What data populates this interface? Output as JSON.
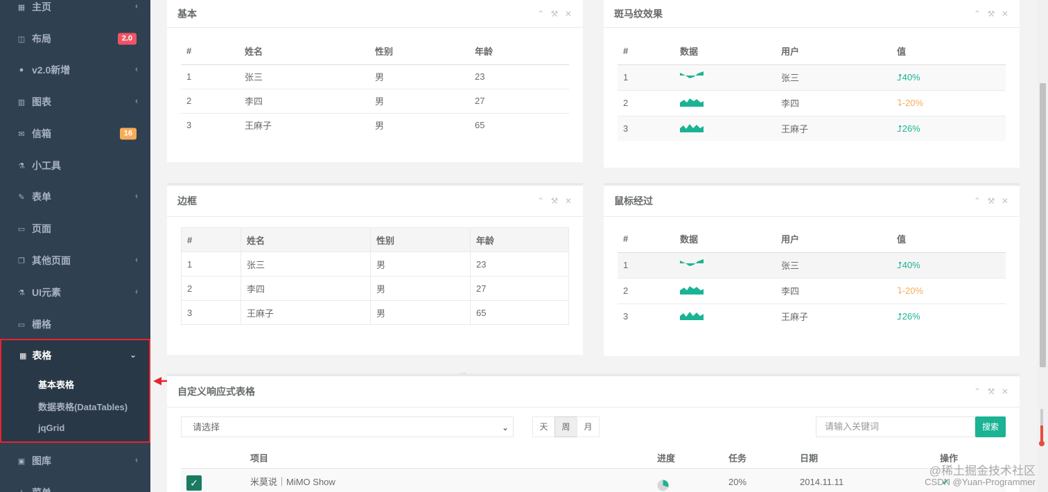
{
  "sidebar": {
    "items": [
      {
        "label": "主页",
        "icon": "grid-icon",
        "chev": "‹"
      },
      {
        "label": "布局",
        "icon": "columns-icon",
        "badge": "2.0",
        "badge_color": "#ed5565"
      },
      {
        "label": "v2.0新增",
        "icon": "globe-icon",
        "chev": "‹"
      },
      {
        "label": "图表",
        "icon": "bar-chart-icon",
        "chev": "‹"
      },
      {
        "label": "信箱",
        "icon": "envelope-icon",
        "badge": "16",
        "badge_color": "#f8ac59"
      },
      {
        "label": "小工具",
        "icon": "flask-icon"
      },
      {
        "label": "表单",
        "icon": "edit-icon",
        "chev": "‹"
      },
      {
        "label": "页面",
        "icon": "desktop-icon"
      },
      {
        "label": "其他页面",
        "icon": "files-icon",
        "chev": "‹"
      },
      {
        "label": "UI元素",
        "icon": "flask-icon",
        "chev": "‹"
      },
      {
        "label": "栅格",
        "icon": "laptop-icon"
      }
    ],
    "active": {
      "label": "表格",
      "chev": "⌄",
      "subitems": [
        "基本表格",
        "数据表格(DataTables)",
        "jqGrid"
      ]
    },
    "after": [
      {
        "label": "图库",
        "icon": "picture-icon",
        "chev": "‹"
      },
      {
        "label": "菜单",
        "icon": "sitemap-icon"
      }
    ]
  },
  "panels": {
    "basic": {
      "title": "基本",
      "headers": [
        "#",
        "姓名",
        "性别",
        "年龄"
      ],
      "rows": [
        [
          "1",
          "张三",
          "男",
          "23"
        ],
        [
          "2",
          "李四",
          "男",
          "27"
        ],
        [
          "3",
          "王麻子",
          "男",
          "65"
        ]
      ]
    },
    "zebra": {
      "title": "斑马纹效果",
      "headers": [
        "#",
        "数据",
        "用户",
        "值"
      ],
      "rows": [
        {
          "n": "1",
          "user": "张三",
          "value": "40%",
          "trend": "up"
        },
        {
          "n": "2",
          "user": "李四",
          "value": "-20%",
          "trend": "down"
        },
        {
          "n": "3",
          "user": "王麻子",
          "value": "26%",
          "trend": "up"
        }
      ]
    },
    "bordered": {
      "title": "边框",
      "headers": [
        "#",
        "姓名",
        "性别",
        "年龄"
      ],
      "rows": [
        [
          "1",
          "张三",
          "男",
          "23"
        ],
        [
          "2",
          "李四",
          "男",
          "27"
        ],
        [
          "3",
          "王麻子",
          "男",
          "65"
        ]
      ]
    },
    "hover": {
      "title": "鼠标经过",
      "headers": [
        "#",
        "数据",
        "用户",
        "值"
      ],
      "rows": [
        {
          "n": "1",
          "user": "张三",
          "value": "40%",
          "trend": "up"
        },
        {
          "n": "2",
          "user": "李四",
          "value": "-20%",
          "trend": "down"
        },
        {
          "n": "3",
          "user": "王麻子",
          "value": "26%",
          "trend": "up"
        }
      ]
    },
    "custom": {
      "title": "自定义响应式表格",
      "select_value": "请选择",
      "range_buttons": [
        "天",
        "周",
        "月"
      ],
      "range_selected": "周",
      "search_placeholder": "请输入关键词",
      "search_button": "搜索",
      "headers": {
        "project": "项目",
        "progress": "进度",
        "task": "任务",
        "date": "日期",
        "action": "操作"
      },
      "row": {
        "project": "米莫说｜MiMO Show",
        "task": "20%",
        "date": "2014.11.11"
      }
    }
  },
  "tools": {
    "collapse": "⌃",
    "wrench": "🔧",
    "close": "✕"
  },
  "colors": {
    "sidebar": "#2f4050",
    "accent": "#1ab394",
    "warning": "#f8ac59",
    "danger": "#ed5565",
    "highlight_border": "#e8232f"
  },
  "watermark": {
    "line1": "@稀土掘金技术社区",
    "line2": "CSDN @Yuan-Programmer"
  }
}
